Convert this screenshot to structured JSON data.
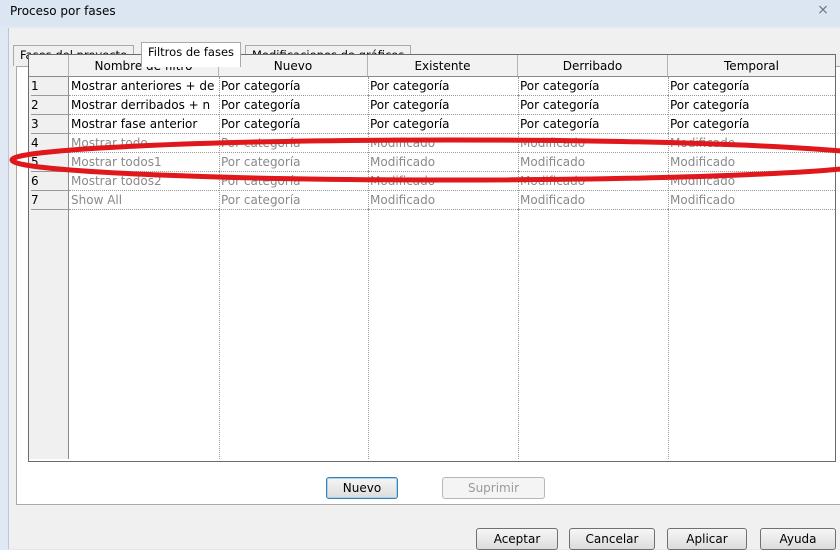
{
  "window": {
    "title": "Proceso por fases",
    "close_label": "⨯"
  },
  "tabs": [
    {
      "label": "Fases del proyecto",
      "active": false
    },
    {
      "label": "Filtros de fases",
      "active": true
    },
    {
      "label": "Modificaciones de gráficos",
      "active": false
    }
  ],
  "grid": {
    "columns": [
      "Nombre de filtro",
      "Nuevo",
      "Existente",
      "Derribado",
      "Temporal"
    ],
    "rows": [
      {
        "num": "1",
        "name": "Mostrar anteriores + de",
        "nuevo": "Por categoría",
        "existente": "Por categoría",
        "derribado": "Por categoría",
        "temporal": "Por categoría",
        "editable": true
      },
      {
        "num": "2",
        "name": "Mostrar derribados + n",
        "nuevo": "Por categoría",
        "existente": "Por categoría",
        "derribado": "Por categoría",
        "temporal": "Por categoría",
        "editable": true
      },
      {
        "num": "3",
        "name": "Mostrar fase anterior",
        "nuevo": "Por categoría",
        "existente": "Por categoría",
        "derribado": "Por categoría",
        "temporal": "Por categoría",
        "editable": true
      },
      {
        "num": "4",
        "name": "Mostrar todo",
        "nuevo": "Por categoría",
        "existente": "Modificado",
        "derribado": "Modificado",
        "temporal": "Modificado",
        "editable": false
      },
      {
        "num": "5",
        "name": "Mostrar todos1",
        "nuevo": "Por categoría",
        "existente": "Modificado",
        "derribado": "Modificado",
        "temporal": "Modificado",
        "editable": false
      },
      {
        "num": "6",
        "name": "Mostrar todos2",
        "nuevo": "Por categoría",
        "existente": "Modificado",
        "derribado": "Modificado",
        "temporal": "Modificado",
        "editable": false
      },
      {
        "num": "7",
        "name": "Show All",
        "nuevo": "Por categoría",
        "existente": "Modificado",
        "derribado": "Modificado",
        "temporal": "Modificado",
        "editable": false
      }
    ]
  },
  "buttons": {
    "nuevo": "Nuevo",
    "suprimir": "Suprimir",
    "aceptar": "Aceptar",
    "cancelar": "Cancelar",
    "aplicar": "Aplicar",
    "ayuda": "Ayuda"
  },
  "annotation": {
    "highlighted_row": "3",
    "color": "#e0171b"
  }
}
